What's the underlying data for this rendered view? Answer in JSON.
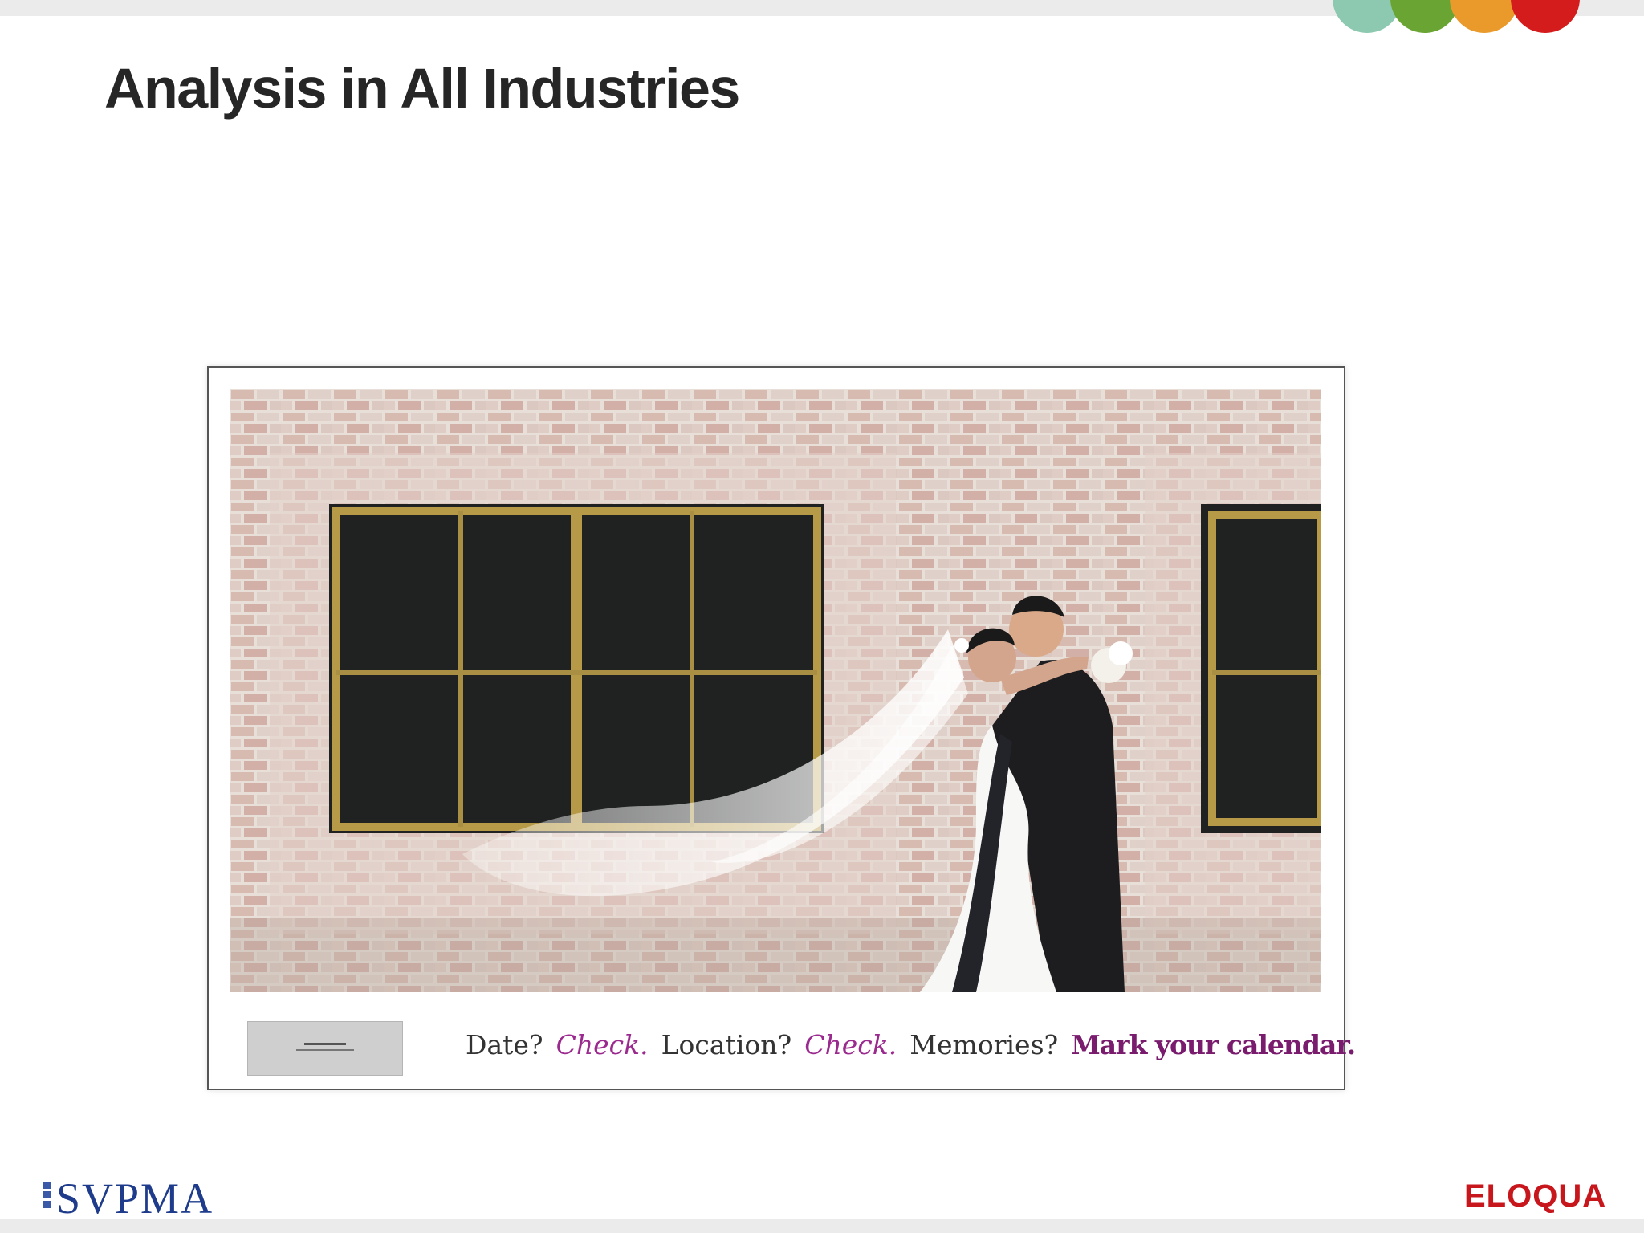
{
  "slide": {
    "title": "Analysis in All Industries",
    "accent_colors": [
      "#8dc8b0",
      "#6aa533",
      "#e99a2b",
      "#d51c1c"
    ]
  },
  "ad": {
    "photo_icon": "wedding-couple-brick-wall-photo",
    "tagline": {
      "q1": "Date?",
      "a1": "Check.",
      "q2": "Location?",
      "a2": "Check.",
      "q3": "Memories?",
      "cta": "Mark your calendar."
    }
  },
  "footer": {
    "left_logo": "SVPMA",
    "right_logo": "ELOQUA"
  }
}
